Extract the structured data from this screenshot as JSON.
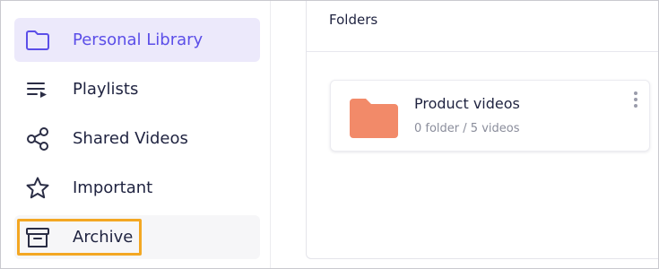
{
  "sidebar": {
    "items": [
      {
        "label": "Personal Library",
        "icon": "folder-icon",
        "state": "active"
      },
      {
        "label": "Playlists",
        "icon": "playlist-icon",
        "state": "normal"
      },
      {
        "label": "Shared Videos",
        "icon": "share-icon",
        "state": "normal"
      },
      {
        "label": "Important",
        "icon": "star-icon",
        "state": "normal"
      },
      {
        "label": "Archive",
        "icon": "archive-icon",
        "state": "hover-highlighted"
      }
    ]
  },
  "main": {
    "title": "Folders",
    "folders": [
      {
        "name": "Product videos",
        "meta": "0 folder / 5 videos",
        "icon": "folder-icon"
      }
    ]
  },
  "colors": {
    "accent": "#5b4ee8",
    "active_bg": "#ece9fb",
    "highlight_border": "#f3a723",
    "folder_color": "#f28a69",
    "text_primary": "#1f2340",
    "text_muted": "#8a8d9b"
  }
}
